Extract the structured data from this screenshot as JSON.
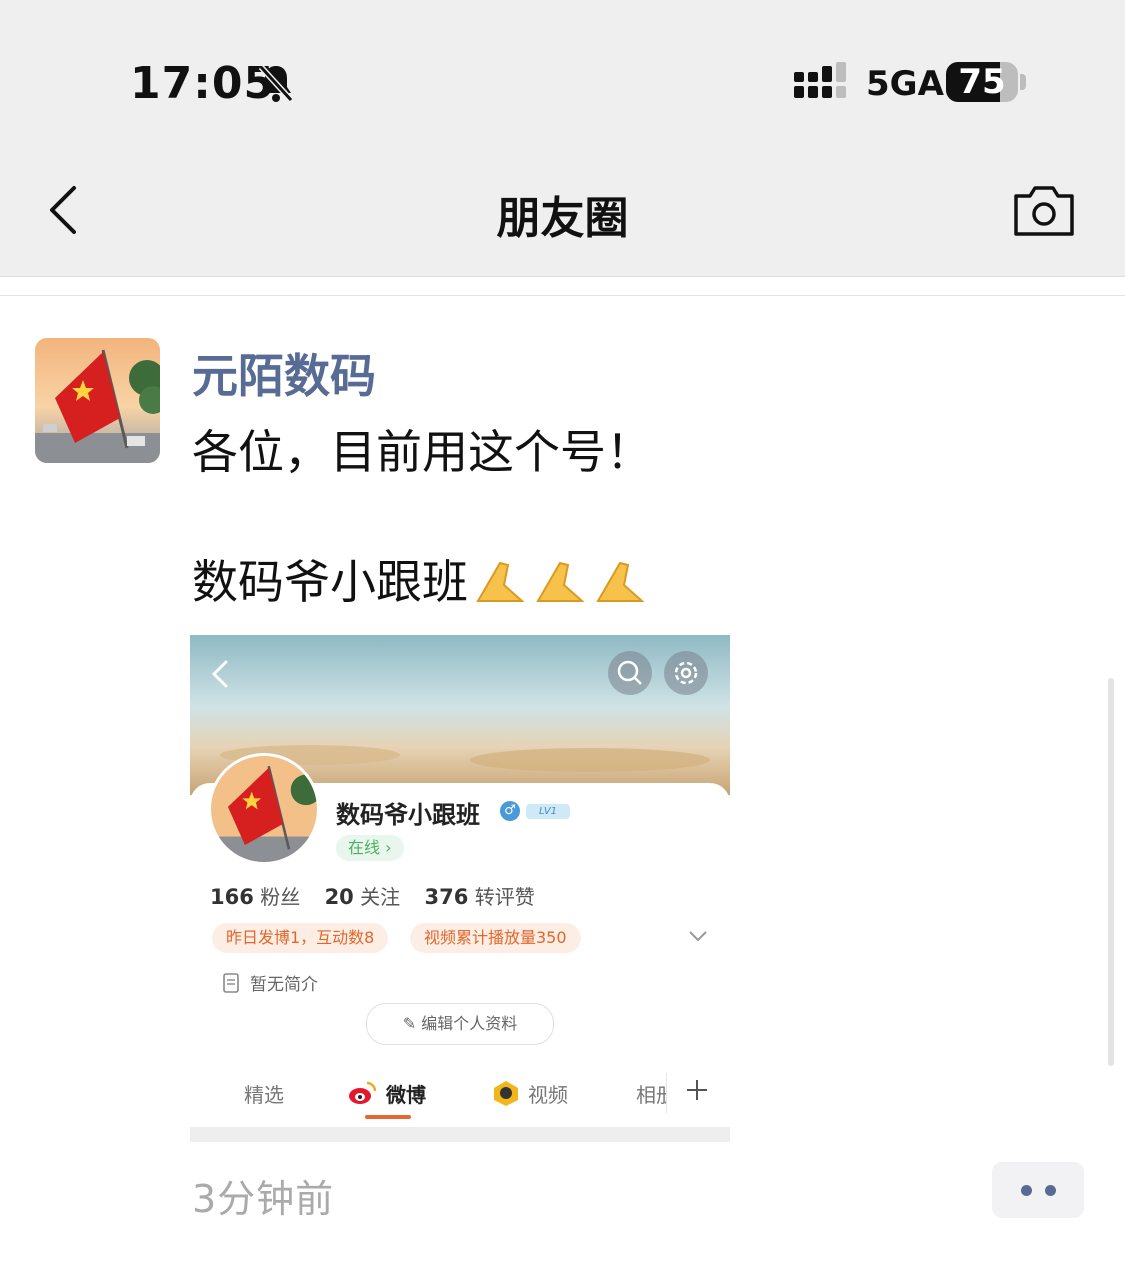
{
  "status_bar": {
    "time": "17:05",
    "network": "5GA",
    "battery": "75",
    "battery_level": 0.75
  },
  "nav": {
    "title": "朋友圈",
    "back_icon": "chevron-left-icon",
    "camera_icon": "camera-icon"
  },
  "post": {
    "author": "元陌数码",
    "line1": "各位，目前用这个号！",
    "line2": "数码爷小跟班",
    "time_ago": "3分钟前",
    "attached_image": {
      "profile_name": "数码爷小跟班",
      "level_badge": "LV1",
      "online_label": "在线",
      "stats": [
        {
          "value": "166",
          "label": "粉丝"
        },
        {
          "value": "20",
          "label": "关注"
        },
        {
          "value": "376",
          "label": "转评赞"
        }
      ],
      "tags": [
        "昨日发博1，互动数8",
        "视频累计播放量350"
      ],
      "intro": "暂无简介",
      "edit_button": "编辑个人资料",
      "tabs": [
        "精选",
        "微博",
        "视频",
        "相册"
      ],
      "active_tab": "微博"
    }
  },
  "colors": {
    "author_link": "#576b95",
    "nav_background": "#efefef",
    "accent_orange": "#e8662f"
  }
}
